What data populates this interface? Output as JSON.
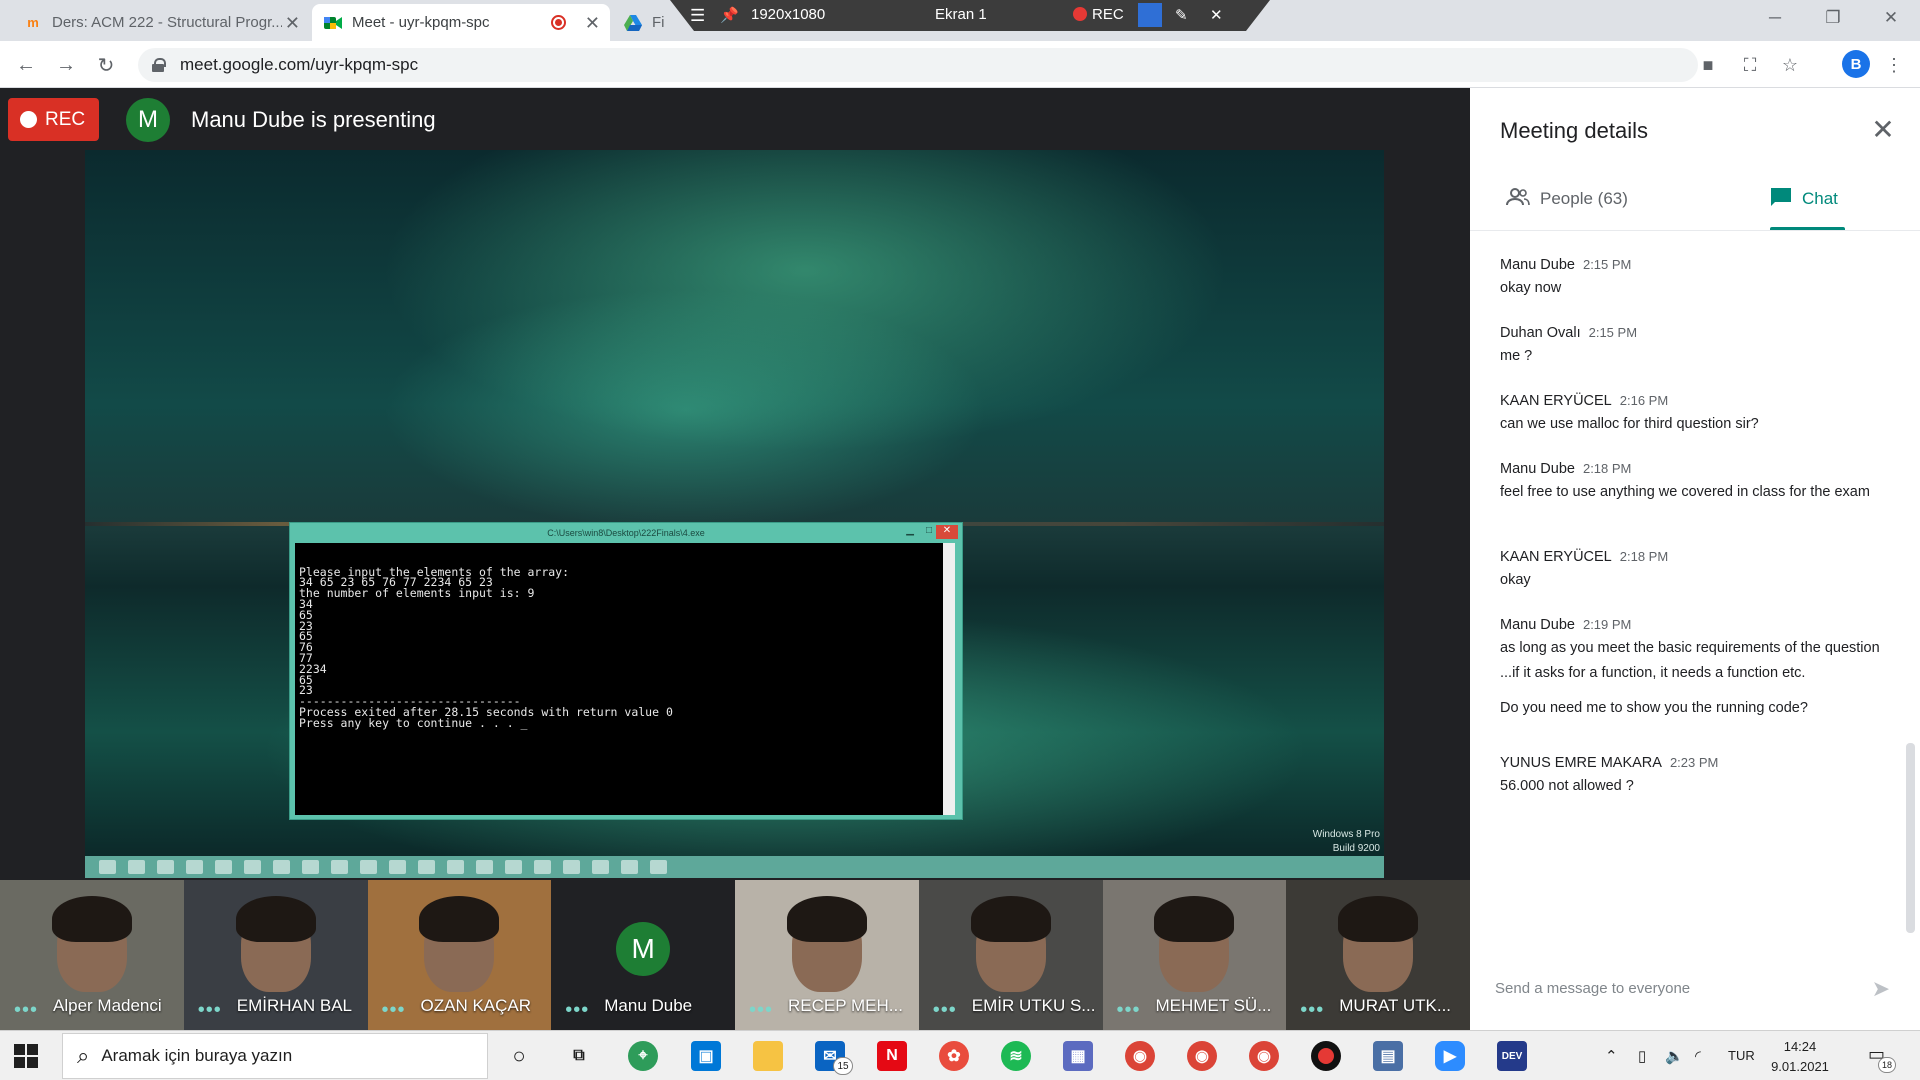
{
  "browser": {
    "tabs": [
      {
        "title": "Ders: ACM 222 - Structural Progr...",
        "active": false
      },
      {
        "title": "Meet - uyr-kpqm-spc",
        "active": true
      },
      {
        "title": "Fi",
        "active": false
      }
    ],
    "url": "meet.google.com/uyr-kpqm-spc",
    "profile_initial": "B"
  },
  "recorder_toolbar": {
    "resolution": "1920x1080",
    "screen": "Ekran 1",
    "rec_label": "REC"
  },
  "meet": {
    "rec_label": "REC",
    "presenter_initial": "M",
    "presenting_text": "Manu Dube is presenting",
    "shared_screen": {
      "console_title": "C:\\Users\\win8\\Desktop\\222Finals\\4.exe",
      "console_lines": [
        "Please input the elements of the array:",
        "34 65 23 65 76 77 2234 65 23",
        "the number of elements input is: 9",
        "34",
        "65",
        "23",
        "65",
        "76",
        "77",
        "2234",
        "65",
        "23",
        "--------------------------------",
        "Process exited after 28.15 seconds with return value 0",
        "Press any key to continue . . . _"
      ],
      "watermark_line1": "Windows 8 Pro",
      "watermark_line2": "Build 9200"
    },
    "participants": [
      {
        "name": "Alper Madenci",
        "bg": "#6a6a62"
      },
      {
        "name": "EMİRHAN BAL",
        "bg": "#3a3e44"
      },
      {
        "name": "OZAN KAÇAR",
        "bg": "#a0703e"
      },
      {
        "name": "Manu Dube",
        "bg": "#202124",
        "initial": "M"
      },
      {
        "name": "RECEP MEH...",
        "bg": "#b8b2a8"
      },
      {
        "name": "EMİR UTKU S...",
        "bg": "#4a4a48"
      },
      {
        "name": "MEHMET SÜ...",
        "bg": "#7a7670"
      },
      {
        "name": "MURAT UTK...",
        "bg": "#3c3a36"
      }
    ]
  },
  "panel": {
    "title": "Meeting details",
    "tab_people": "People (63)",
    "tab_chat": "Chat",
    "messages": [
      {
        "sender": "Manu Dube",
        "time": "2:15 PM",
        "texts": [
          "okay now"
        ]
      },
      {
        "sender": "Duhan Ovalı",
        "time": "2:15 PM",
        "texts": [
          "me ?"
        ]
      },
      {
        "sender": "KAAN ERYÜCEL",
        "time": "2:16 PM",
        "texts": [
          "can we use malloc for third question sir?"
        ]
      },
      {
        "sender": "Manu Dube",
        "time": "2:18 PM",
        "texts": [
          "feel free to use anything we covered in class for the exam"
        ]
      },
      {
        "sender": "KAAN ERYÜCEL",
        "time": "2:18 PM",
        "texts": [
          "okay"
        ]
      },
      {
        "sender": "Manu Dube",
        "time": "2:19 PM",
        "texts": [
          "as long as you meet the basic requirements of the question ...if it asks for a function, it needs a function etc.",
          "Do you need me to show you the running code?"
        ]
      },
      {
        "sender": "YUNUS EMRE MAKARA",
        "time": "2:23 PM",
        "texts": [
          "56.000 not allowed ?"
        ]
      }
    ],
    "input_placeholder": "Send a message to everyone"
  },
  "taskbar": {
    "search_placeholder": "Aramak için buraya yazın",
    "mail_badge": "15",
    "language": "TUR",
    "time": "14:24",
    "date": "9.01.2021",
    "notification_count": "18",
    "icon_colors": {
      "netflix": "#e50914",
      "spotify": "#1db954",
      "zoom": "#2d8cff",
      "store": "#0078d7"
    }
  }
}
